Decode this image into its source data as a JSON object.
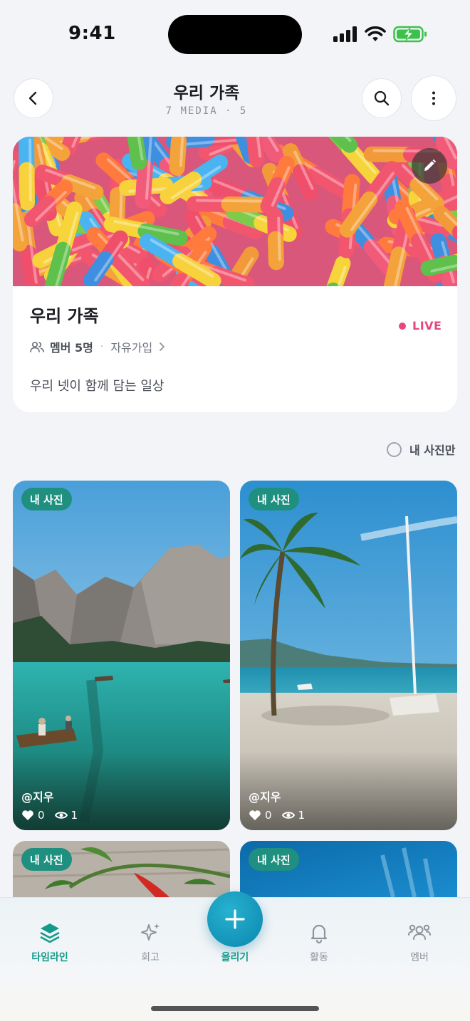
{
  "status_bar": {
    "time": "9:41"
  },
  "header": {
    "title": "우리 가족",
    "subtitle": "7 MEDIA · 5"
  },
  "album": {
    "name": "우리 가족",
    "live_label": "LIVE",
    "member_count": "멤버 5명",
    "separator": "·",
    "join_type": "자유가입",
    "description": "우리 넷이 함께 담는 일상"
  },
  "filter": {
    "label": "내 사진만",
    "checked": false
  },
  "photos": [
    {
      "badge": "내 사진",
      "uploader": "@지우",
      "likes": "0",
      "views": "1",
      "scene": "mountain lake with rowboat"
    },
    {
      "badge": "내 사진",
      "uploader": "@지우",
      "likes": "0",
      "views": "1",
      "scene": "palm tree beach with sailboat"
    },
    {
      "badge": "내 사진",
      "scene": "chili pepper on wooden table"
    },
    {
      "badge": "내 사진",
      "scene": "blue ocean"
    }
  ],
  "nav": {
    "items": [
      {
        "label": "타임라인",
        "icon": "layers-icon",
        "active": true
      },
      {
        "label": "회고",
        "icon": "sparkle-icon",
        "active": false
      },
      {
        "label": "올리기",
        "icon": "plus-icon",
        "active": true
      },
      {
        "label": "활동",
        "icon": "bell-icon",
        "active": false
      },
      {
        "label": "멤버",
        "icon": "members-icon",
        "active": false
      }
    ]
  },
  "colors": {
    "accent": "#149a8a",
    "badge": "#1f8f80",
    "live": "#e8477e",
    "fab": "#1393b8"
  }
}
